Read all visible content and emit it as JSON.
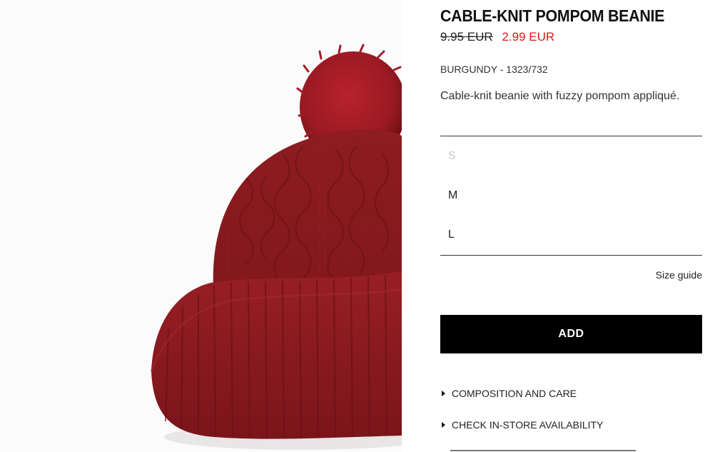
{
  "product": {
    "title": "CABLE-KNIT POMPOM BEANIE",
    "old_price": "9.95 EUR",
    "new_price": "2.99 EUR",
    "color_ref": "BURGUNDY - 1323/732",
    "description": "Cable-knit beanie with fuzzy pompom appliqué."
  },
  "sizes": [
    {
      "label": "S",
      "available": false
    },
    {
      "label": "M",
      "available": true
    },
    {
      "label": "L",
      "available": true
    }
  ],
  "size_guide_label": "Size guide",
  "add_label": "ADD",
  "accordions": [
    {
      "label": "COMPOSITION AND CARE"
    },
    {
      "label": "CHECK IN-STORE AVAILABILITY"
    }
  ],
  "colors": {
    "sale": "#e01818",
    "button": "#000000",
    "beanie": "#8e1b1f",
    "pompom": "#9e1a22"
  },
  "image": {
    "icon": "beanie-photo"
  }
}
